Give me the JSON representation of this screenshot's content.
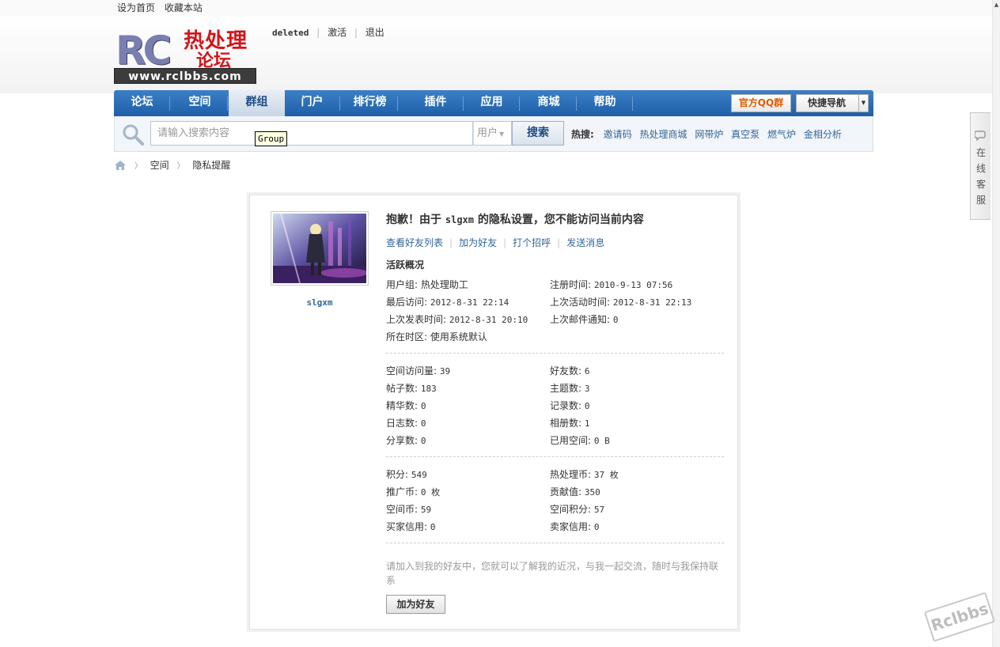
{
  "topbar": {
    "set_home": "设为首页",
    "bookmark": "收藏本站"
  },
  "logo": {
    "rc": "RC",
    "cn_line1": "热处理",
    "cn_line2": "论坛",
    "url": "www.rclbbs.com"
  },
  "usermenu": {
    "username": "deleted",
    "activate": "激活",
    "logout": "退出"
  },
  "nav": {
    "items": [
      "论坛",
      "空间",
      "群组",
      "门户",
      "排行榜",
      "插件",
      "应用",
      "商城",
      "帮助"
    ],
    "active_index": 2,
    "qq_group": "官方QQ群",
    "quick_nav": "快捷导航"
  },
  "search": {
    "placeholder": "请输入搜索内容",
    "type": "用户",
    "button": "搜索",
    "hot_label": "热搜:",
    "hot_keywords": [
      "邀请码",
      "热处理商城",
      "网带炉",
      "真空泵",
      "燃气炉",
      "金相分析"
    ]
  },
  "tooltip": "Group",
  "breadcrumb": {
    "items": [
      "空间",
      "隐私提醒"
    ]
  },
  "profile": {
    "username": "slgxm",
    "title_prefix": "抱歉！由于 ",
    "title_user": "slgxm",
    "title_suffix": " 的隐私设置，您不能访问当前内容",
    "actions": [
      "查看好友列表",
      "加为好友",
      "打个招呼",
      "发送消息"
    ],
    "section_title": "活跃概况",
    "activity": [
      {
        "label": "用户组: ",
        "value": "热处理助工"
      },
      {
        "label": "注册时间: ",
        "value": "2010-9-13 07:56"
      },
      {
        "label": "最后访问: ",
        "value": "2012-8-31 22:14"
      },
      {
        "label": "上次活动时间: ",
        "value": "2012-8-31 22:13"
      },
      {
        "label": "上次发表时间: ",
        "value": "2012-8-31 20:10"
      },
      {
        "label": "上次邮件通知: ",
        "value": "0"
      },
      {
        "label": "所在时区: ",
        "value": "使用系统默认"
      }
    ],
    "counts": [
      {
        "label": "空间访问量: ",
        "value": "39"
      },
      {
        "label": "好友数: ",
        "value": "6"
      },
      {
        "label": "帖子数: ",
        "value": "183"
      },
      {
        "label": "主题数: ",
        "value": "3"
      },
      {
        "label": "精华数: ",
        "value": "0"
      },
      {
        "label": "记录数: ",
        "value": "0"
      },
      {
        "label": "日志数: ",
        "value": "0"
      },
      {
        "label": "相册数: ",
        "value": "1"
      },
      {
        "label": "分享数: ",
        "value": "0"
      },
      {
        "label": "已用空间: ",
        "value": "0 B"
      }
    ],
    "credits": [
      {
        "label": "积分: ",
        "value": "549"
      },
      {
        "label": "热处理币: ",
        "value": "37 枚"
      },
      {
        "label": "推广币: ",
        "value": "0 枚"
      },
      {
        "label": "贡献值: ",
        "value": "350"
      },
      {
        "label": "空间币: ",
        "value": "59"
      },
      {
        "label": "空间积分: ",
        "value": "57"
      },
      {
        "label": "买家信用: ",
        "value": "0"
      },
      {
        "label": "卖家信用: ",
        "value": "0"
      }
    ],
    "invite_text": "请加入到我的好友中，您就可以了解我的近况，与我一起交流，随时与我保持联系",
    "add_friend_button": "加为好友"
  },
  "service": {
    "label": "在线客服"
  },
  "watermark": "Rclbbs",
  "colors": {
    "nav_blue": "#1e5fa8",
    "link_blue": "#336699",
    "qq_orange": "#e05a00"
  }
}
